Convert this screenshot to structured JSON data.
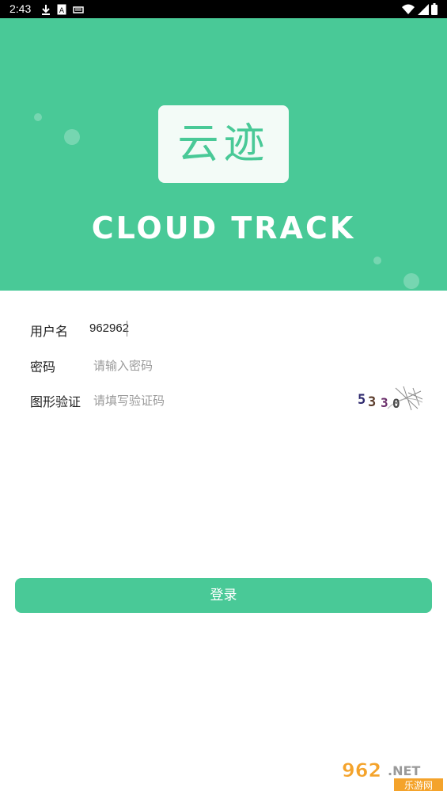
{
  "status_bar": {
    "time": "2:43",
    "icons_left": [
      "download-icon",
      "a-icon",
      "sd-card-icon"
    ],
    "icons_right": [
      "wifi-icon",
      "signal-icon",
      "battery-icon"
    ]
  },
  "hero": {
    "logo_text": "云迹",
    "brand": "CLOUD TRACK",
    "background": "#49c997"
  },
  "form": {
    "username": {
      "label": "用户名",
      "value": "962962"
    },
    "password": {
      "label": "密码",
      "placeholder": "请输入密码"
    },
    "captcha": {
      "label": "图形验证",
      "placeholder": "请填写验证码",
      "image_text": "5330"
    }
  },
  "login": {
    "label": "登录"
  },
  "watermark": {
    "top": "962.NET",
    "bottom": "乐游网"
  }
}
